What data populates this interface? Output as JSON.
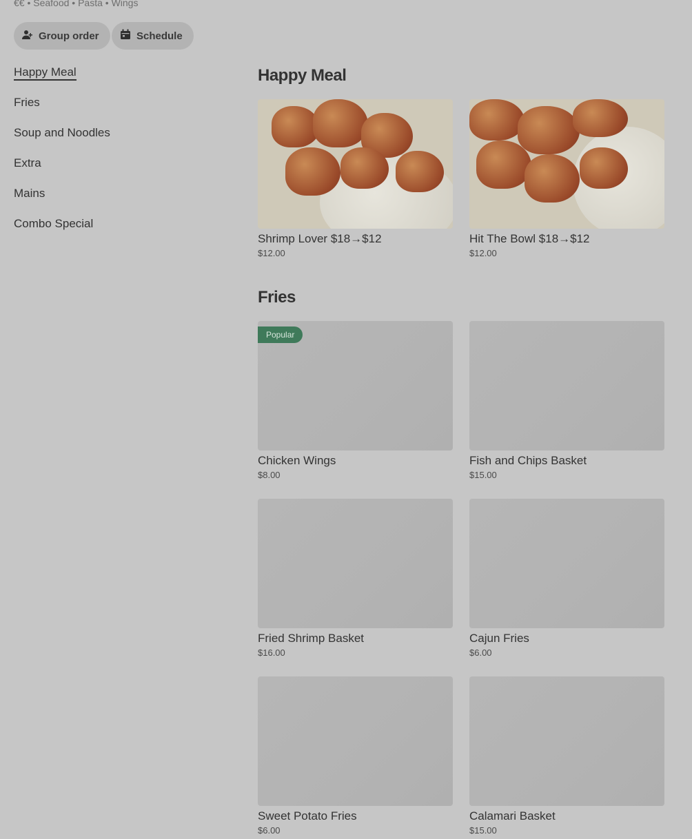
{
  "restaurant": {
    "meta": "€€ • Seafood • Pasta • Wings"
  },
  "actions": {
    "group_order": "Group order",
    "schedule": "Schedule"
  },
  "sidebar": {
    "items": [
      {
        "label": "Happy Meal",
        "active": true
      },
      {
        "label": "Fries"
      },
      {
        "label": "Soup and Noodles"
      },
      {
        "label": "Extra"
      },
      {
        "label": "Mains"
      },
      {
        "label": "Combo Special"
      }
    ]
  },
  "sections": [
    {
      "title": "Happy Meal",
      "items": [
        {
          "name": "Shrimp Lover $18→$12",
          "price": "$12.00"
        },
        {
          "name": "Hit The Bowl $18→$12",
          "price": "$12.00"
        }
      ]
    },
    {
      "title": "Fries",
      "items": [
        {
          "name": "Chicken Wings",
          "price": "$8.00",
          "badge": "Popular"
        },
        {
          "name": "Fish and Chips Basket",
          "price": "$15.00"
        },
        {
          "name": "Fried Shrimp Basket",
          "price": "$16.00"
        },
        {
          "name": "Cajun Fries",
          "price": "$6.00"
        },
        {
          "name": "Sweet Potato Fries",
          "price": "$6.00"
        },
        {
          "name": "Calamari Basket",
          "price": "$15.00"
        }
      ]
    }
  ]
}
